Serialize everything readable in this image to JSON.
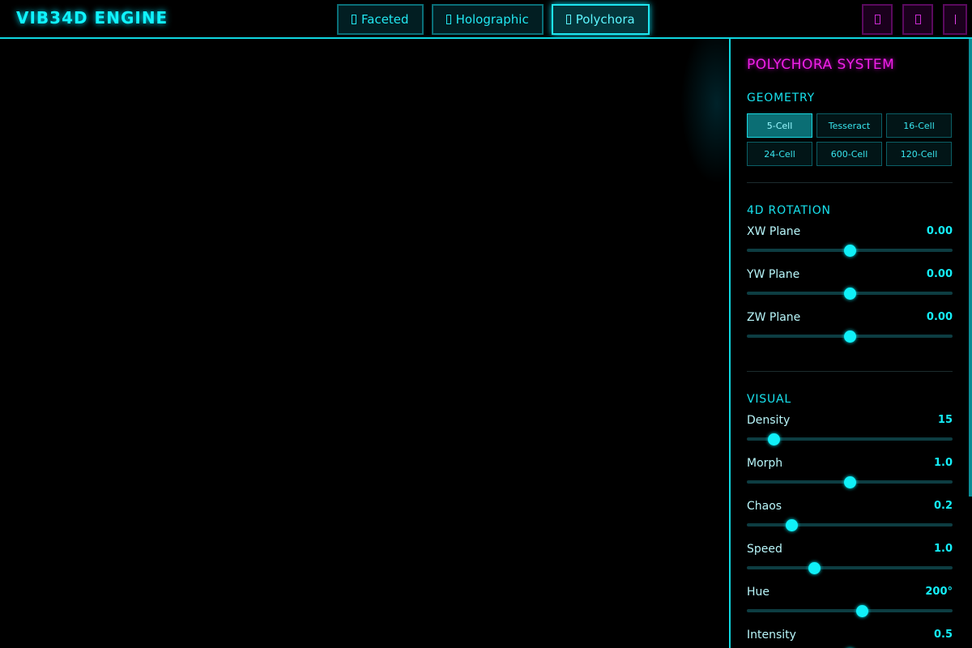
{
  "app": {
    "title": "VIB34D ENGINE"
  },
  "mode_tabs": [
    {
      "label": "Faceted",
      "icon": "faceted-icon",
      "active": false
    },
    {
      "label": "Holographic",
      "icon": "holographic-icon",
      "active": false
    },
    {
      "label": "Polychora",
      "icon": "polychora-icon",
      "active": true
    }
  ],
  "top_actions": [
    {
      "icon": "action-icon-1"
    },
    {
      "icon": "action-icon-2"
    },
    {
      "icon": "menu-bar-icon"
    }
  ],
  "panel": {
    "title": "POLYCHORA SYSTEM",
    "geometry": {
      "title": "GEOMETRY",
      "options": [
        "5-Cell",
        "Tesseract",
        "16-Cell",
        "24-Cell",
        "600-Cell",
        "120-Cell"
      ],
      "selected": "5-Cell"
    },
    "rotation": {
      "title": "4D ROTATION",
      "sliders": [
        {
          "label": "XW Plane",
          "value": "0.00",
          "fraction": 0.5
        },
        {
          "label": "YW Plane",
          "value": "0.00",
          "fraction": 0.5
        },
        {
          "label": "ZW Plane",
          "value": "0.00",
          "fraction": 0.5
        }
      ]
    },
    "visual": {
      "title": "VISUAL",
      "sliders": [
        {
          "label": "Density",
          "value": "15",
          "fraction": 0.13
        },
        {
          "label": "Morph",
          "value": "1.0",
          "fraction": 0.5
        },
        {
          "label": "Chaos",
          "value": "0.2",
          "fraction": 0.22
        },
        {
          "label": "Speed",
          "value": "1.0",
          "fraction": 0.33
        },
        {
          "label": "Hue",
          "value": "200°",
          "fraction": 0.56
        },
        {
          "label": "Intensity",
          "value": "0.5",
          "fraction": 0.5
        }
      ]
    }
  },
  "colors": {
    "accent": "#00f0ff",
    "brand": "#f020e8",
    "background": "#000000"
  }
}
